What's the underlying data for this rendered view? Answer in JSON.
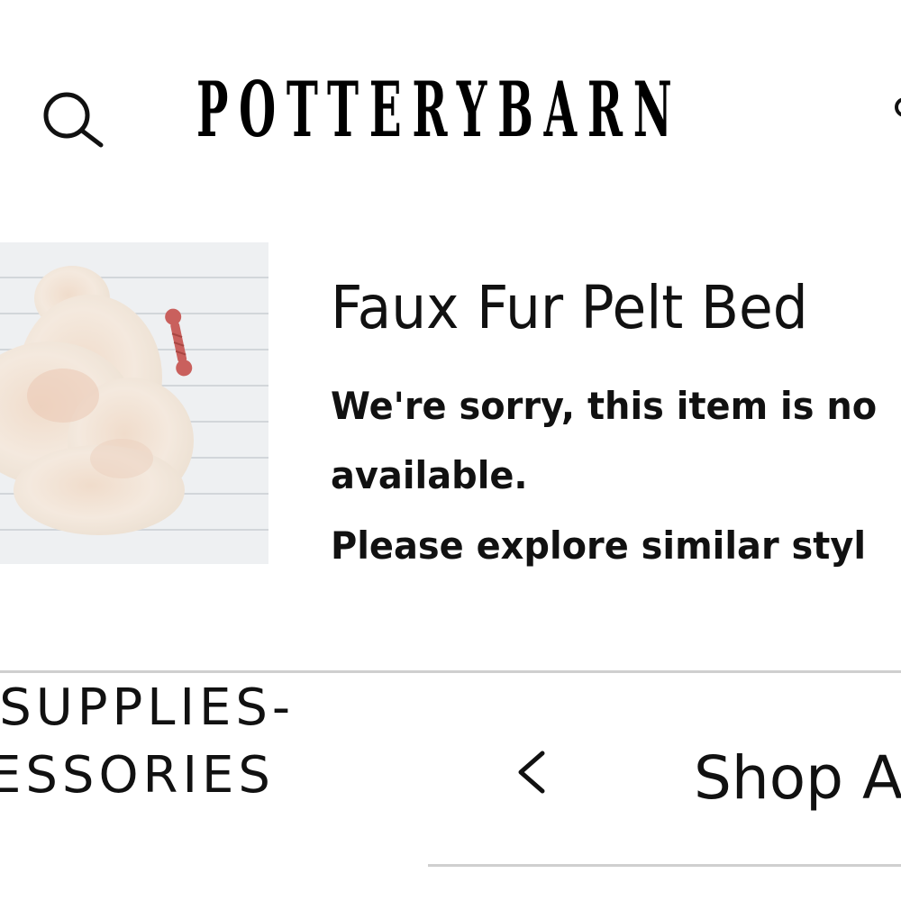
{
  "header": {
    "logo_text": "POTTERYBARN",
    "search_icon": "search-icon",
    "edge_icon": "partial-icon"
  },
  "product": {
    "image_alt": "faux fur pelt bed with rope dog toy",
    "title": "Faux Fur Pelt Bed",
    "unavailable_line1": "We're sorry, this item is no",
    "unavailable_line2": "available.",
    "explore_line": "Please explore similar styl"
  },
  "category_nav": {
    "line1": "-SUPPLIES-",
    "line2": "ESSORIES",
    "back_icon": "chevron-left-icon",
    "shop_all_label": "Shop A"
  },
  "colors": {
    "text": "#111111",
    "divider": "#cfcfcf",
    "image_background": "#eef0f2",
    "fur": "#f2e6da",
    "toy": "#c9605d"
  }
}
